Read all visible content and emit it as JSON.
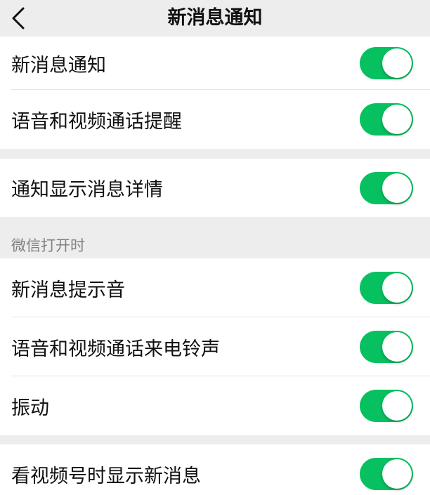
{
  "nav": {
    "title": "新消息通知",
    "back_icon": "chevron-left-icon"
  },
  "colors": {
    "toggle_on": "#07c160",
    "background": "#ededed",
    "cell": "#ffffff",
    "section_header_text": "#808080"
  },
  "group1": {
    "items": [
      {
        "label": "新消息通知",
        "enabled": true
      },
      {
        "label": "语音和视频通话提醒",
        "enabled": true
      }
    ]
  },
  "group2": {
    "items": [
      {
        "label": "通知显示消息详情",
        "enabled": true
      }
    ]
  },
  "section3": {
    "header": "微信打开时",
    "items": [
      {
        "label": "新消息提示音",
        "enabled": true
      },
      {
        "label": "语音和视频通话来电铃声",
        "enabled": true
      },
      {
        "label": "振动",
        "enabled": true
      }
    ]
  },
  "group4": {
    "items": [
      {
        "label": "看视频号时显示新消息",
        "enabled": true
      }
    ]
  }
}
